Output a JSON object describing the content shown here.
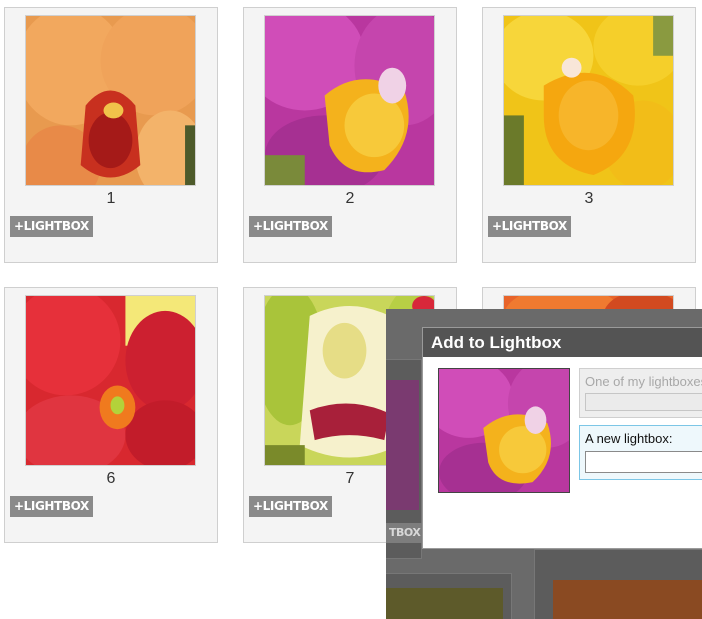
{
  "gallery": {
    "items": [
      {
        "number": "1",
        "lightbox_label": "+LIGHTBOX"
      },
      {
        "number": "2",
        "lightbox_label": "+LIGHTBOX"
      },
      {
        "number": "3",
        "lightbox_label": "+LIGHTBOX"
      },
      {
        "number": "6",
        "lightbox_label": "+LIGHTBOX"
      },
      {
        "number": "7",
        "lightbox_label": "+LIGHTBOX"
      }
    ]
  },
  "overlay": {
    "partial_button_label": "TBOX"
  },
  "dialog": {
    "title": "Add to Lightbox",
    "existing_label": "One of my lightboxes:",
    "new_label": "A new lightbox:",
    "new_value": ""
  },
  "colors": {
    "dialog_title_bg": "#545454",
    "lightbox_button_bg": "#8a8a8a",
    "new_option_border": "#7cc6e6"
  }
}
